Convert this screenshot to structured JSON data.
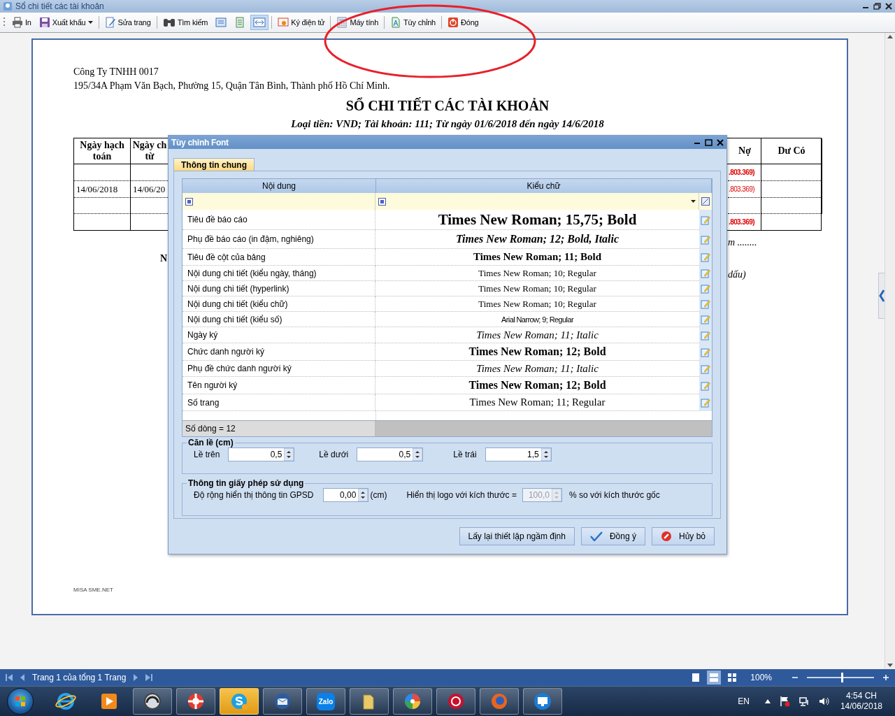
{
  "window": {
    "title": "Sổ chi tiết các tài khoản"
  },
  "toolbar": [
    {
      "kind": "print",
      "label": "In",
      "menu": false
    },
    {
      "kind": "export",
      "label": "Xuất khẩu",
      "menu": true
    },
    {
      "kind": "separator"
    },
    {
      "kind": "edit-page",
      "label": "Sửa trang",
      "menu": false
    },
    {
      "kind": "separator"
    },
    {
      "kind": "search",
      "label": "Tìm kiếm",
      "menu": false
    },
    {
      "kind": "view-single",
      "selected": false
    },
    {
      "kind": "view-two",
      "selected": false
    },
    {
      "kind": "view-fit",
      "selected": true
    },
    {
      "kind": "separator"
    },
    {
      "kind": "sign",
      "label": "Ký điện tử",
      "menu": false
    },
    {
      "kind": "separator"
    },
    {
      "kind": "calculator",
      "label": "Máy tính",
      "menu": false
    },
    {
      "kind": "separator"
    },
    {
      "kind": "customize",
      "label": "Tùy chỉnh",
      "menu": false
    },
    {
      "kind": "separator"
    },
    {
      "kind": "close",
      "label": "Đóng",
      "menu": false
    }
  ],
  "report": {
    "company": "Công Ty TNHH 0017",
    "address": "195/34A Phạm Văn Bạch, Phường 15, Quận Tân Bình, Thành phố Hồ Chí Minh.",
    "title": "SỔ CHI TIẾT CÁC TÀI KHOẢN",
    "subtitle": "Loại tiền: VND; Tài khoản: 111; Từ ngày 01/6/2018 đến ngày 14/6/2018",
    "table": {
      "columns": [
        {
          "label": "Ngày hạch toán"
        },
        {
          "lines": [
            "Ngày ch",
            "từ"
          ]
        },
        {
          "label": "Nợ"
        },
        {
          "label": "Dư Có"
        }
      ],
      "rows": [
        {
          "kind": "summary",
          "column_3": ".803.369)"
        },
        {
          "kind": "detail",
          "column_1": "14/06/2018",
          "column_2": "14/06/20",
          "column_3": ".803.369)"
        },
        {
          "kind": "blank"
        },
        {
          "kind": "summary",
          "column_3": ".803.369)"
        }
      ]
    },
    "signature": {
      "left": "N",
      "right": [
        "m ........",
        "dấu)"
      ]
    },
    "brand": "MISA SME.NET"
  },
  "dialog": {
    "title": "Tùy chỉnh Font",
    "tabs": [
      {
        "label": "Thông tin chung",
        "selected": true
      }
    ],
    "grid": {
      "columns": [
        "Nội dung",
        "Kiểu chữ"
      ],
      "rows": [
        {
          "label": "Tiêu đề báo cáo",
          "font": "Times New Roman; 15,75; Bold",
          "kind": "heading"
        },
        {
          "label": "Phụ đề báo cáo (in đậm, nghiêng)",
          "font": "Times New Roman; 12; Bold, Italic",
          "kind": "bold-italic"
        },
        {
          "label": "Tiêu đề cột của bảng",
          "font": "Times New Roman; 11; Bold",
          "kind": "bold"
        },
        {
          "label": "Nội dung chi tiết (kiểu ngày, tháng)",
          "font": "Times New Roman; 10; Regular",
          "kind": "regular"
        },
        {
          "label": "Nội dung chi tiết (hyperlink)",
          "font": "Times New Roman; 10; Regular",
          "kind": "regular"
        },
        {
          "label": "Nội dung chi tiết (kiểu chữ)",
          "font": "Times New Roman; 10; Regular",
          "kind": "regular"
        },
        {
          "label": "Nội dung chi tiết (kiểu số)",
          "font": "Arial Narrow; 9; Regular",
          "kind": "narrow"
        },
        {
          "label": "Ngày ký",
          "font": "Times New Roman; 11; Italic",
          "kind": "italic"
        },
        {
          "label": "Chức danh người ký",
          "font": "Times New Roman; 12; Bold",
          "kind": "bold-large"
        },
        {
          "label": "Phụ đề chức danh người ký",
          "font": "Times New Roman; 11; Italic",
          "kind": "italic"
        },
        {
          "label": "Tên người ký",
          "font": "Times New Roman; 12; Bold",
          "kind": "bold-large"
        },
        {
          "label": "Số trang",
          "font": "Times New Roman; 11; Regular",
          "kind": "regular-large"
        }
      ],
      "footer": "Số dòng = 12"
    },
    "margins": {
      "title": "Căn lề (cm)",
      "fields": [
        {
          "label": "Lề trên",
          "value": "0,5"
        },
        {
          "label": "Lề dưới",
          "value": "0,5"
        },
        {
          "label": "Lề trái",
          "value": "1,5"
        }
      ]
    },
    "license": {
      "title": "Thông tin giấy phép sử dụng",
      "width_label": "Độ rộng hiển thị thông tin GPSD",
      "width_value": "0,00",
      "width_unit": "(cm)",
      "logo_label": "Hiển thị logo với kích thước =",
      "logo_value": "100,0",
      "logo_disabled": true,
      "logo_suffix": "% so với kích thước gốc"
    },
    "buttons": [
      {
        "kind": "reset",
        "label": "Lấy lại thiết lập ngầm định"
      },
      {
        "kind": "ok",
        "label": "Đồng ý"
      },
      {
        "kind": "cancel",
        "label": "Hủy bỏ"
      }
    ]
  },
  "status_bar": {
    "page_label": "Trang 1 của tổng 1 Trang",
    "views": [
      {
        "kind": "single",
        "selected": false
      },
      {
        "kind": "double",
        "selected": true
      },
      {
        "kind": "grid",
        "selected": false
      }
    ],
    "zoom": "100%",
    "zoom_slider": {
      "level": 0.52
    }
  },
  "taskbar": {
    "apps": [
      {
        "kind": "ie",
        "running": false,
        "attention": false
      },
      {
        "kind": "media",
        "running": false,
        "attention": false
      },
      {
        "kind": "support",
        "running": true,
        "attention": false
      },
      {
        "kind": "lifebuoy",
        "running": true,
        "attention": false
      },
      {
        "kind": "skype",
        "running": true,
        "attention": true
      },
      {
        "kind": "mail",
        "running": true,
        "attention": false
      },
      {
        "kind": "zalo",
        "label": "Zalo",
        "running": true,
        "attention": false
      },
      {
        "kind": "folder",
        "running": true,
        "attention": false
      },
      {
        "kind": "pinwheel",
        "running": true,
        "attention": false
      },
      {
        "kind": "ring",
        "running": true,
        "attention": false
      },
      {
        "kind": "firefox",
        "running": true,
        "attention": false
      },
      {
        "kind": "remote",
        "running": true,
        "attention": false
      }
    ],
    "language": "EN",
    "time": "4:54 CH",
    "date": "14/06/2018"
  }
}
